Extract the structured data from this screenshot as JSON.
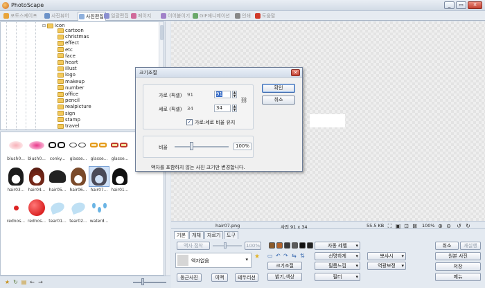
{
  "window": {
    "title": "PhotoScape",
    "controls": [
      "_",
      "▭",
      "✕"
    ]
  },
  "tabs": [
    {
      "label": "포토스케이프",
      "icon": "photoscape-icon",
      "color": "#e8a43a",
      "active": false
    },
    {
      "label": "사진뷰어",
      "icon": "viewer-icon",
      "color": "#6c92c8",
      "active": false
    },
    {
      "label": "사진편집",
      "icon": "editor-icon",
      "color": "#8fb0dc",
      "active": true
    },
    {
      "label": "일괄편집",
      "icon": "batch-icon",
      "color": "#8a8fd0",
      "active": false
    },
    {
      "label": "페이지",
      "icon": "page-icon",
      "color": "#d06a9a",
      "active": false
    },
    {
      "label": "이어붙이기",
      "icon": "combine-icon",
      "color": "#a080c8",
      "active": false
    },
    {
      "label": "GIF애니메이션",
      "icon": "gif-icon",
      "color": "#6aa86a",
      "active": false
    },
    {
      "label": "인쇄",
      "icon": "print-icon",
      "color": "#888888",
      "active": false
    },
    {
      "label": "도움말",
      "icon": "help-icon",
      "color": "#d03a2a",
      "active": false
    }
  ],
  "tree": {
    "root": "icon",
    "folders": [
      "cartoon",
      "christmas",
      "effect",
      "etc",
      "face",
      "heart",
      "illust",
      "logo",
      "makeup",
      "number",
      "office",
      "pencil",
      "realpicture",
      "sign",
      "stamp",
      "travel"
    ]
  },
  "thumbnails": [
    {
      "label": "blush0...",
      "kind": "blush-light"
    },
    {
      "label": "blush0...",
      "kind": "blush-pink"
    },
    {
      "label": "conky...",
      "kind": "glasses-black"
    },
    {
      "label": "glasse...",
      "kind": "glasses-thin"
    },
    {
      "label": "glasse...",
      "kind": "glasses-orange"
    },
    {
      "label": "glasse...",
      "kind": "glasses-red"
    },
    {
      "label": "hair03...",
      "kind": "hair-curly"
    },
    {
      "label": "hair04...",
      "kind": "hair-red"
    },
    {
      "label": "hair05...",
      "kind": "hair-short"
    },
    {
      "label": "hair06...",
      "kind": "hair-brown"
    },
    {
      "label": "hair07...",
      "kind": "hair-grey",
      "selected": true
    },
    {
      "label": "hair01...",
      "kind": "hair-bob"
    },
    {
      "label": "rednos...",
      "kind": "rednose-small"
    },
    {
      "label": "rednos...",
      "kind": "rednose-big"
    },
    {
      "label": "tear01...",
      "kind": "tear"
    },
    {
      "label": "tear02...",
      "kind": "tear"
    },
    {
      "label": "waterd...",
      "kind": "waterdrop"
    }
  ],
  "status": {
    "filename": "hair07.png",
    "dimensions": "사진 91 x 34",
    "filesize": "55.5 KB",
    "zoom": "100%"
  },
  "editor": {
    "tabs": [
      "기본",
      "개체",
      "자르기",
      "도구"
    ],
    "frame_button": "액자 접착",
    "frame_percent": "100%",
    "frame_select": "액자없음",
    "round_photo": "둥근사진",
    "margin": "여백",
    "border": "테두리선",
    "auto_level": "자동 레벨",
    "sharpen": "선명하게",
    "blur": "뽀샤시",
    "resize": "크기조절",
    "film_effect": "필름느낌",
    "backlight": "역광보정",
    "brightness": "밝기,색상",
    "filter": "필터",
    "cancel": "취소",
    "redo": "재실행",
    "original": "원본 사진",
    "save": "저장",
    "menu": "메뉴",
    "swatch_colors": [
      "#8a5a2a",
      "#b0622a",
      "#3a3a3a",
      "#5a5a5a",
      "#111111",
      "#222222"
    ]
  },
  "dialog": {
    "title": "크기조절",
    "width_label": "가로 (픽셀)",
    "width_current": "91",
    "width_value": "91",
    "height_label": "세로 (픽셀)",
    "height_current": "34",
    "height_value": "34",
    "keep_ratio_label": "가로:세로 비율 유지",
    "keep_ratio_checked": "✓",
    "ratio_label": "비율",
    "ratio_value": "100%",
    "ratio_level": 1.0,
    "note": "액자를 포함하지 않는 사진 크기만 변경합니다.",
    "ok": "확인",
    "cancel": "취소"
  }
}
